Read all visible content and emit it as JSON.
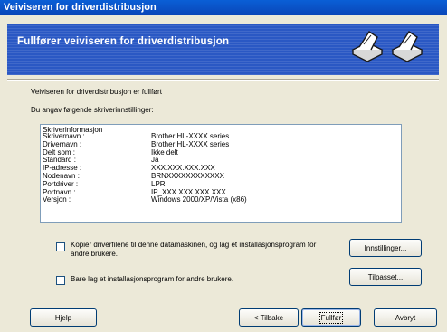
{
  "window": {
    "title": "Veiviseren for driverdistribusjon"
  },
  "header": {
    "title": "Fullfører veiviseren for driverdistribusjon"
  },
  "body": {
    "done_text": "Veiviseren for driverdistribusjon er fullført",
    "settings_intro": "Du angav følgende skriverinnstillinger:"
  },
  "info": {
    "heading": "Skriverinformasjon",
    "rows": [
      {
        "label": "Skrivernavn :",
        "value": "Brother HL-XXXX series"
      },
      {
        "label": "Drivernavn :",
        "value": "Brother HL-XXXX series"
      },
      {
        "label": "Delt som :",
        "value": "Ikke delt"
      },
      {
        "label": "Standard :",
        "value": "Ja"
      },
      {
        "label": "IP-adresse :",
        "value": "XXX.XXX.XXX.XXX"
      },
      {
        "label": "Nodenavn :",
        "value": "BRNXXXXXXXXXXXX"
      },
      {
        "label": "Portdriver :",
        "value": "LPR"
      },
      {
        "label": "Portnavn :",
        "value": "IP_XXX.XXX.XXX.XXX"
      },
      {
        "label": "Versjon :",
        "value": "Windows 2000/XP/Vista (x86)"
      }
    ]
  },
  "options": {
    "copy_checkbox": {
      "line1": "Kopier driverfilene til denne datamaskinen, og lag et installasjonsprogram for",
      "line2": "andre brukere.",
      "checked": false
    },
    "only_checkbox": {
      "label": "Bare lag et installasjonsprogram for andre brukere.",
      "checked": false
    }
  },
  "buttons": {
    "settings": "Innstillinger...",
    "custom": "Tilpasset...",
    "help": "Hjelp",
    "back": "< Tilbake",
    "finish": "Fullfør",
    "cancel": "Avbryt"
  }
}
